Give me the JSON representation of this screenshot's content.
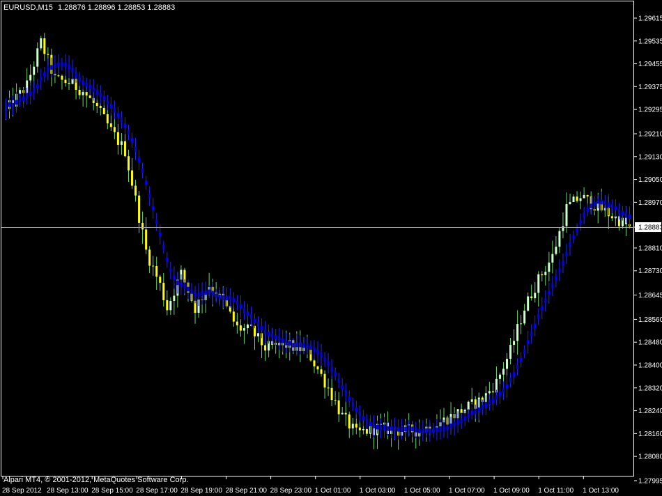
{
  "header": {
    "symbol_label": "EURUSD,M15",
    "ohlc_text": "1.28876 1.28896 1.28853 1.28883"
  },
  "footer": {
    "copyright": "Alpari MT4, © 2001-2012, MetaQuotes Software Corp."
  },
  "colors": {
    "background": "#000000",
    "bull": "#ccffcc",
    "bear": "#ffff00",
    "wick_up": "#66dd66",
    "indicator": "#0000ff",
    "indicator_wick": "#2222ff",
    "axis": "#ffffff",
    "current_price_line": "#aaaaaa"
  },
  "chart_data": {
    "type": "candlestick",
    "symbol": "EURUSD",
    "timeframe": "M15",
    "current_price": 1.28883,
    "ylim": [
      1.27995,
      1.29655
    ],
    "y_ticks": [
      "1.29615",
      "1.29535",
      "1.29455",
      "1.29375",
      "1.29295",
      "1.29210",
      "1.29130",
      "1.29050",
      "1.28970",
      "1.28883",
      "1.28810",
      "1.28730",
      "1.28645",
      "1.28560",
      "1.28480",
      "1.28400",
      "1.28320",
      "1.28240",
      "1.28160",
      "1.28080",
      "1.27995"
    ],
    "x_ticks": [
      "28 Sep 2012",
      "28 Sep 13:00",
      "28 Sep 15:00",
      "28 Sep 17:00",
      "28 Sep 19:00",
      "28 Sep 21:00",
      "28 Sep 23:00",
      "1 Oct 01:00",
      "1 Oct 03:00",
      "1 Oct 05:00",
      "1 Oct 07:00",
      "1 Oct 09:00",
      "1 Oct 11:00",
      "1 Oct 13:00"
    ],
    "anchors": [
      [
        0,
        1.2929
      ],
      [
        6,
        1.2938
      ],
      [
        10,
        1.2953
      ],
      [
        14,
        1.294
      ],
      [
        18,
        1.2939
      ],
      [
        22,
        1.2936
      ],
      [
        26,
        1.293
      ],
      [
        30,
        1.2922
      ],
      [
        34,
        1.2915
      ],
      [
        37,
        1.2898
      ],
      [
        40,
        1.288
      ],
      [
        44,
        1.2868
      ],
      [
        46,
        1.286
      ],
      [
        50,
        1.2872
      ],
      [
        54,
        1.286
      ],
      [
        58,
        1.2868
      ],
      [
        62,
        1.2862
      ],
      [
        66,
        1.2853
      ],
      [
        70,
        1.2852
      ],
      [
        74,
        1.2846
      ],
      [
        80,
        1.2847
      ],
      [
        86,
        1.2845
      ],
      [
        92,
        1.2832
      ],
      [
        96,
        1.2822
      ],
      [
        100,
        1.2816
      ],
      [
        106,
        1.2818
      ],
      [
        112,
        1.2817
      ],
      [
        118,
        1.2817
      ],
      [
        124,
        1.282
      ],
      [
        130,
        1.2824
      ],
      [
        136,
        1.2828
      ],
      [
        140,
        1.2834
      ],
      [
        144,
        1.2845
      ],
      [
        148,
        1.286
      ],
      [
        152,
        1.287
      ],
      [
        156,
        1.2878
      ],
      [
        160,
        1.2895
      ],
      [
        164,
        1.2899
      ],
      [
        168,
        1.2896
      ],
      [
        172,
        1.2893
      ],
      [
        176,
        1.289
      ],
      [
        178,
        1.2888
      ]
    ],
    "candle_count": 179
  }
}
